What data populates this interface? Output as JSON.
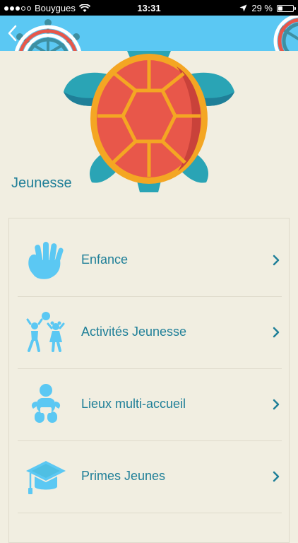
{
  "status_bar": {
    "carrier": "Bouygues",
    "time": "13:31",
    "battery": "29 %",
    "battery_level": 0.29,
    "signal_bars": 3
  },
  "header": {
    "back_icon": "chevron-left-icon",
    "decor_icon": "ship-wheel-icon",
    "color": "#5bc8f3"
  },
  "hero": {
    "icon": "turtle-icon"
  },
  "section": {
    "title": "Jeunesse"
  },
  "menu": {
    "items": [
      {
        "label": "Enfance",
        "icon": "hand-icon"
      },
      {
        "label": "Activités Jeunesse",
        "icon": "children-playing-icon"
      },
      {
        "label": "Lieux multi-accueil",
        "icon": "baby-icon"
      },
      {
        "label": "Primes Jeunes",
        "icon": "graduation-cap-icon"
      }
    ]
  },
  "colors": {
    "accent": "#1f7f98",
    "icon_blue": "#5bc8f3",
    "background": "#f1eee1",
    "turtle_shell": "#e8574a",
    "turtle_rim": "#f4a623",
    "turtle_limbs": "#2aa4b5"
  }
}
